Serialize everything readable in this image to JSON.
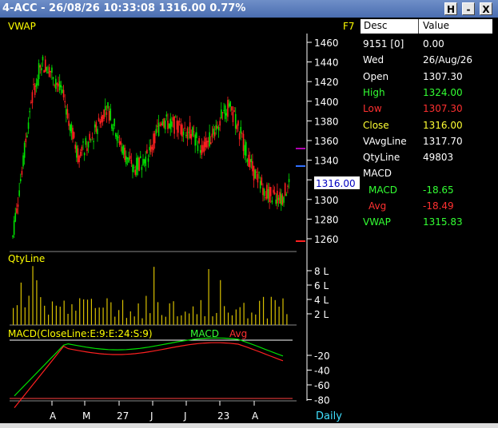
{
  "window": {
    "title": "4-ACC - 26/08/26 10:33:08 1316.00 0.77%",
    "buttons": [
      "H",
      "-",
      "X"
    ]
  },
  "chart": {
    "price_label": "VWAP",
    "shortcut": "F7",
    "price_ticks": [
      "1460",
      "1440",
      "1420",
      "1400",
      "1380",
      "1360",
      "1340",
      "1320",
      "1300",
      "1280",
      "1260"
    ],
    "current_price": "1316.00",
    "qty_label": "QtyLine",
    "qty_ticks": [
      "8 L",
      "6 L",
      "4 L",
      "2 L"
    ],
    "macd_label": "MACD(CloseLine:E:9:E:24:S:9)",
    "macd_line_label": "MACD",
    "macd_avg_label": "Avg",
    "macd_ticks": [
      "-20",
      "-40",
      "-60",
      "-80"
    ],
    "x_ticks": [
      "A",
      "M",
      "27",
      "J",
      "J",
      "23",
      "A"
    ],
    "period": "Daily",
    "colors": {
      "up": "#00e000",
      "down": "#ff2020",
      "label": "#ffff00",
      "axis": "#ffffff",
      "current": "#ffffff"
    }
  },
  "table": {
    "headers": [
      "Desc",
      "Value"
    ],
    "rows": [
      {
        "k": "9151 [0]",
        "v": "0.00",
        "color": "#ffffff"
      },
      {
        "k": "Wed",
        "v": "26/Aug/26",
        "color": "#ffffff"
      },
      {
        "k": "Open",
        "v": "1307.30",
        "color": "#ffffff"
      },
      {
        "k": "High",
        "v": "1324.00",
        "color": "#33ff33"
      },
      {
        "k": "Low",
        "v": "1307.30",
        "color": "#ff3030"
      },
      {
        "k": "Close",
        "v": "1316.00",
        "color": "#ffff33"
      },
      {
        "k": "VAvgLine",
        "v": "1317.70",
        "color": "#ffffff"
      },
      {
        "k": "QtyLine",
        "v": "49803",
        "color": "#ffffff"
      },
      {
        "k": "MACD",
        "v": "",
        "color": "#ffffff"
      },
      {
        "k": " MACD",
        "v": "-18.65",
        "color": "#33ff33"
      },
      {
        "k": " Avg",
        "v": "-18.49",
        "color": "#ff3030"
      },
      {
        "k": "VWAP",
        "v": "1315.83",
        "color": "#33ff33"
      }
    ]
  }
}
